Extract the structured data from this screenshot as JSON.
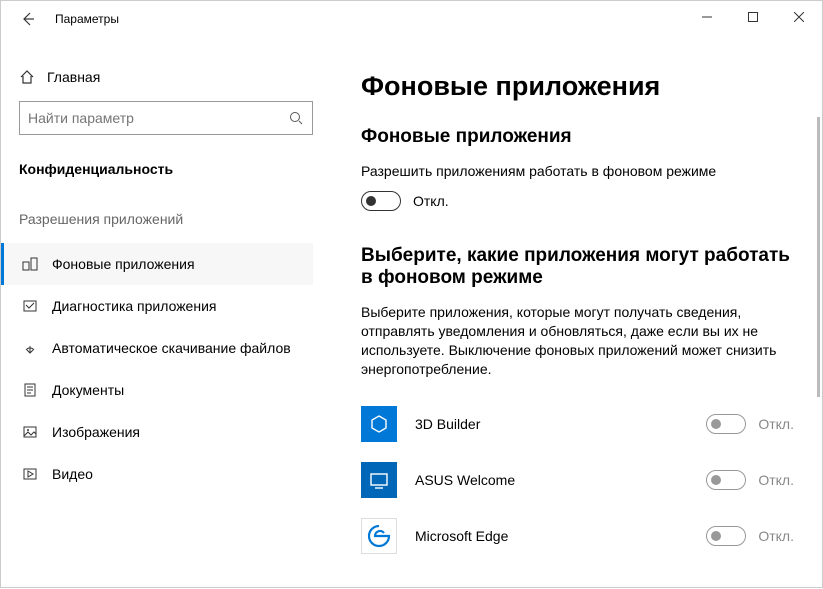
{
  "titlebar": {
    "title": "Параметры"
  },
  "sidebar": {
    "home_label": "Главная",
    "search_placeholder": "Найти параметр",
    "category_label": "Конфиденциальность",
    "group_label": "Разрешения приложений",
    "items": [
      {
        "label": "Фоновые приложения",
        "active": true
      },
      {
        "label": "Диагностика приложения",
        "active": false
      },
      {
        "label": "Автоматическое скачивание файлов",
        "active": false
      },
      {
        "label": "Документы",
        "active": false
      },
      {
        "label": "Изображения",
        "active": false
      },
      {
        "label": "Видео",
        "active": false
      }
    ]
  },
  "content": {
    "page_title": "Фоновые приложения",
    "master": {
      "heading": "Фоновые приложения",
      "desc": "Разрешить приложениям работать в фоновом режиме",
      "state_label": "Откл."
    },
    "apps_section": {
      "heading": "Выберите, какие приложения могут работать в фоновом режиме",
      "desc": "Выберите приложения, которые могут получать сведения, отправлять уведомления и обновляться, даже если вы их не используете. Выключение фоновых приложений может снизить энергопотребление."
    },
    "apps": [
      {
        "name": "3D Builder",
        "icon_bg": "#0078d7",
        "state_label": "Откл."
      },
      {
        "name": "ASUS Welcome",
        "icon_bg": "#0067b8",
        "state_label": "Откл."
      },
      {
        "name": "Microsoft Edge",
        "icon_bg": "#ffffff",
        "state_label": "Откл."
      }
    ]
  }
}
